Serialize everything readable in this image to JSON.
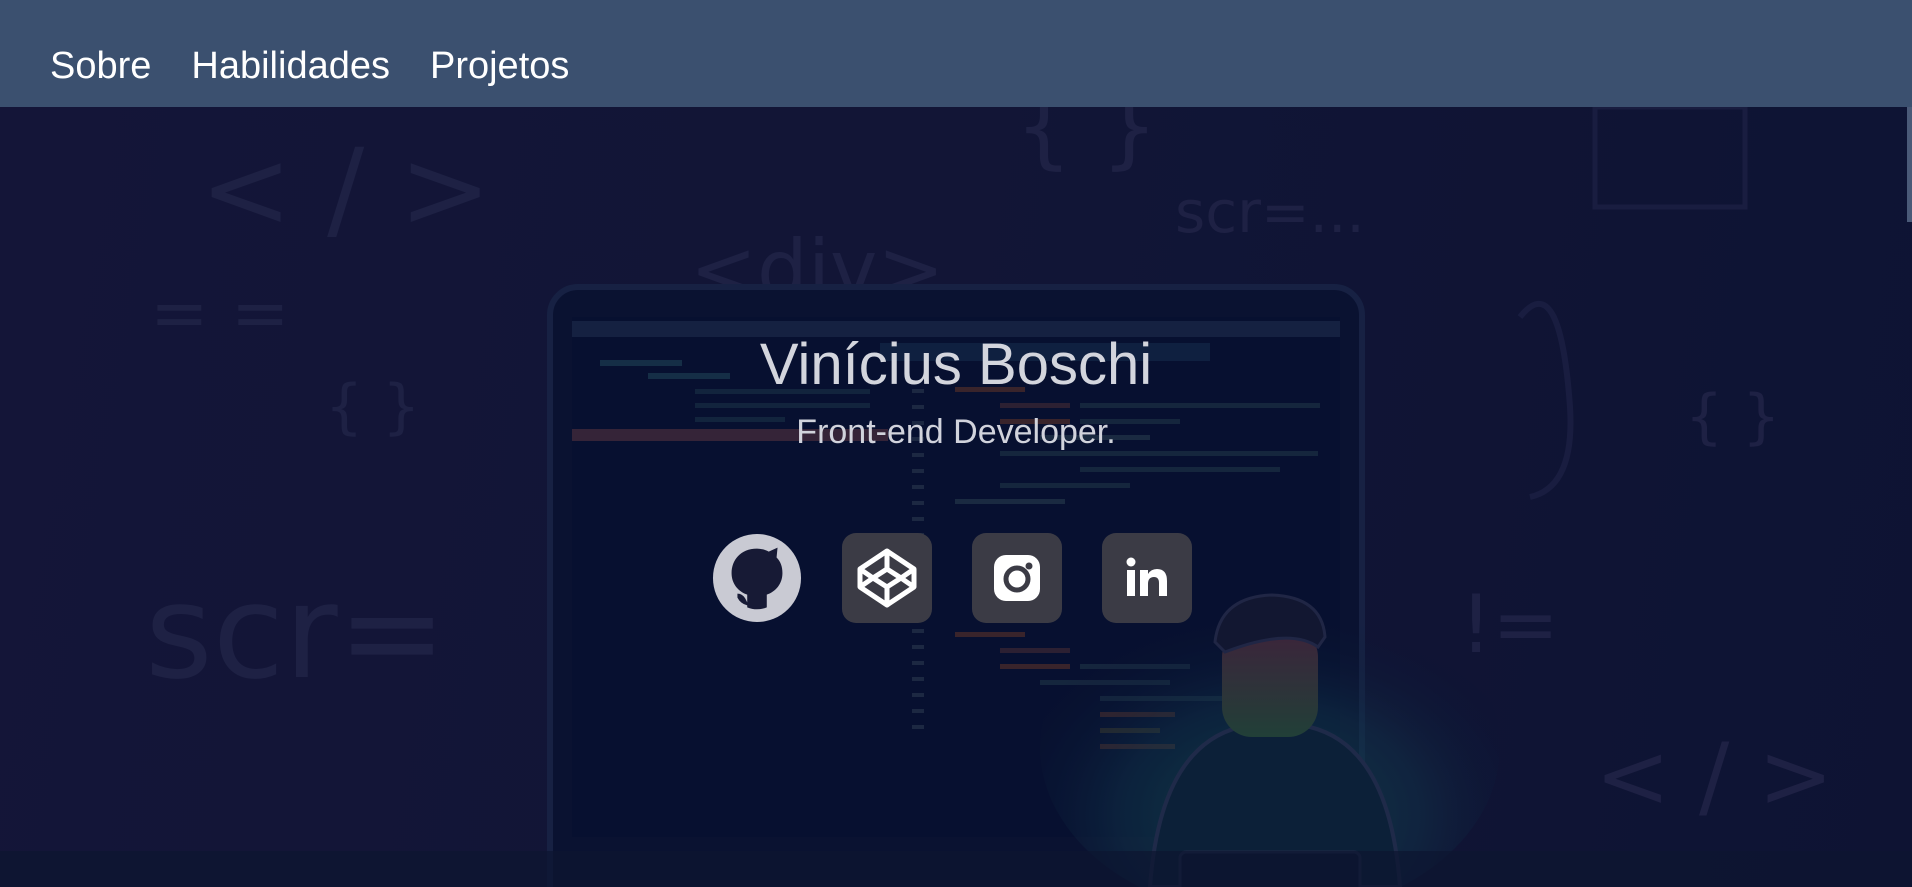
{
  "nav": {
    "items": [
      {
        "label": "Sobre"
      },
      {
        "label": "Habilidades"
      },
      {
        "label": "Projetos"
      }
    ]
  },
  "hero": {
    "name": "Vinícius Boschi",
    "role": "Front-end Developer.",
    "background_text": [
      "< / >",
      "{ }",
      "scr=...",
      "<div>",
      "= =",
      "{ }",
      "scr=",
      "!=",
      "< / >",
      "{ }"
    ]
  },
  "social": [
    {
      "icon": "github-icon"
    },
    {
      "icon": "codepen-icon"
    },
    {
      "icon": "instagram-icon"
    },
    {
      "icon": "linkedin-icon"
    }
  ],
  "colors": {
    "navbar": "#3b506f",
    "hero_bg": "#161a3a",
    "text": "#d3d5dd",
    "social_bg": "#3b3b45"
  }
}
